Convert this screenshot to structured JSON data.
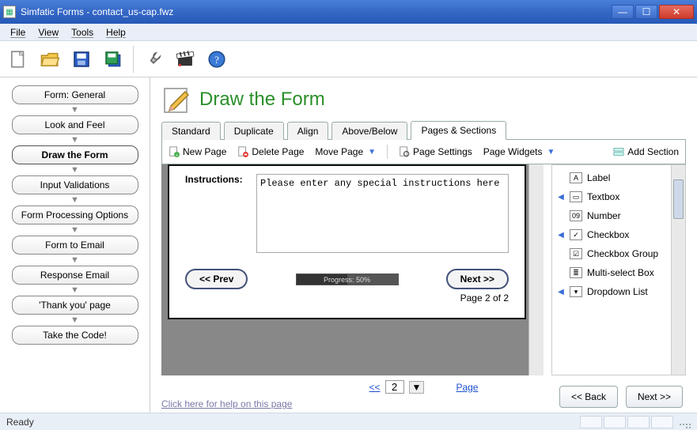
{
  "window": {
    "title": "Simfatic Forms - contact_us-cap.fwz"
  },
  "menus": [
    "File",
    "View",
    "Tools",
    "Help"
  ],
  "sidebar": {
    "steps": [
      "Form: General",
      "Look and Feel",
      "Draw the Form",
      "Input Validations",
      "Form Processing Options",
      "Form to Email",
      "Response Email",
      "'Thank you' page",
      "Take the Code!"
    ],
    "active_index": 2
  },
  "page": {
    "title": "Draw the Form",
    "tabs": [
      "Standard",
      "Duplicate",
      "Align",
      "Above/Below",
      "Pages & Sections"
    ],
    "active_tab": 4,
    "subtoolbar": {
      "new_page": "New Page",
      "delete_page": "Delete Page",
      "move_page": "Move Page",
      "page_settings": "Page Settings",
      "page_widgets": "Page Widgets",
      "add_section": "Add Section"
    },
    "form": {
      "instructions_label": "Instructions:",
      "instructions_value": "Please enter any special instructions here",
      "prev_label": "<< Prev",
      "next_label": "Next >>",
      "progress_text": "Progress: 50%",
      "page_counter": "Page 2 of 2"
    },
    "pager": {
      "prev_symbol": "<<",
      "value": "2",
      "page_link": "Page"
    },
    "help_link": "Click here for help on this page",
    "bottom": {
      "back": "<< Back",
      "next": "Next >>"
    }
  },
  "palette": [
    "Label",
    "Textbox",
    "Number",
    "Checkbox",
    "Checkbox Group",
    "Multi-select Box",
    "Dropdown List"
  ],
  "status": {
    "ready": "Ready"
  }
}
